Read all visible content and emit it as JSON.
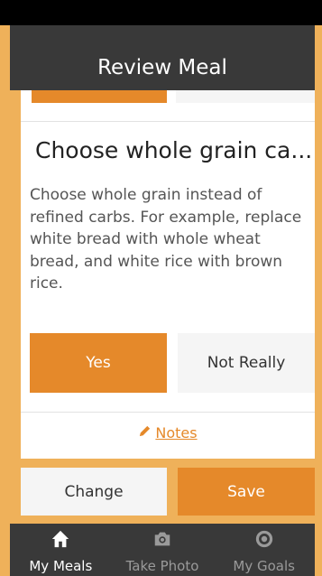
{
  "header": {
    "title": "Review Meal"
  },
  "tip": {
    "title": "Choose whole grain ca...",
    "body": "Choose whole grain instead of refined carbs. For example, replace white bread with whole wheat bread, and white rice with brown rice."
  },
  "answers": {
    "yes_label": "Yes",
    "no_label": "Not Really"
  },
  "notes": {
    "label": "Notes",
    "icon": "pencil-icon"
  },
  "actions": {
    "change_label": "Change",
    "save_label": "Save"
  },
  "tabs": [
    {
      "label": "My Meals",
      "icon": "home-icon",
      "active": true
    },
    {
      "label": "Take Photo",
      "icon": "camera-icon",
      "active": false
    },
    {
      "label": "My Goals",
      "icon": "target-icon",
      "active": false
    }
  ],
  "colors": {
    "accent": "#e5892a",
    "background": "#efb15a",
    "header": "#393939"
  }
}
